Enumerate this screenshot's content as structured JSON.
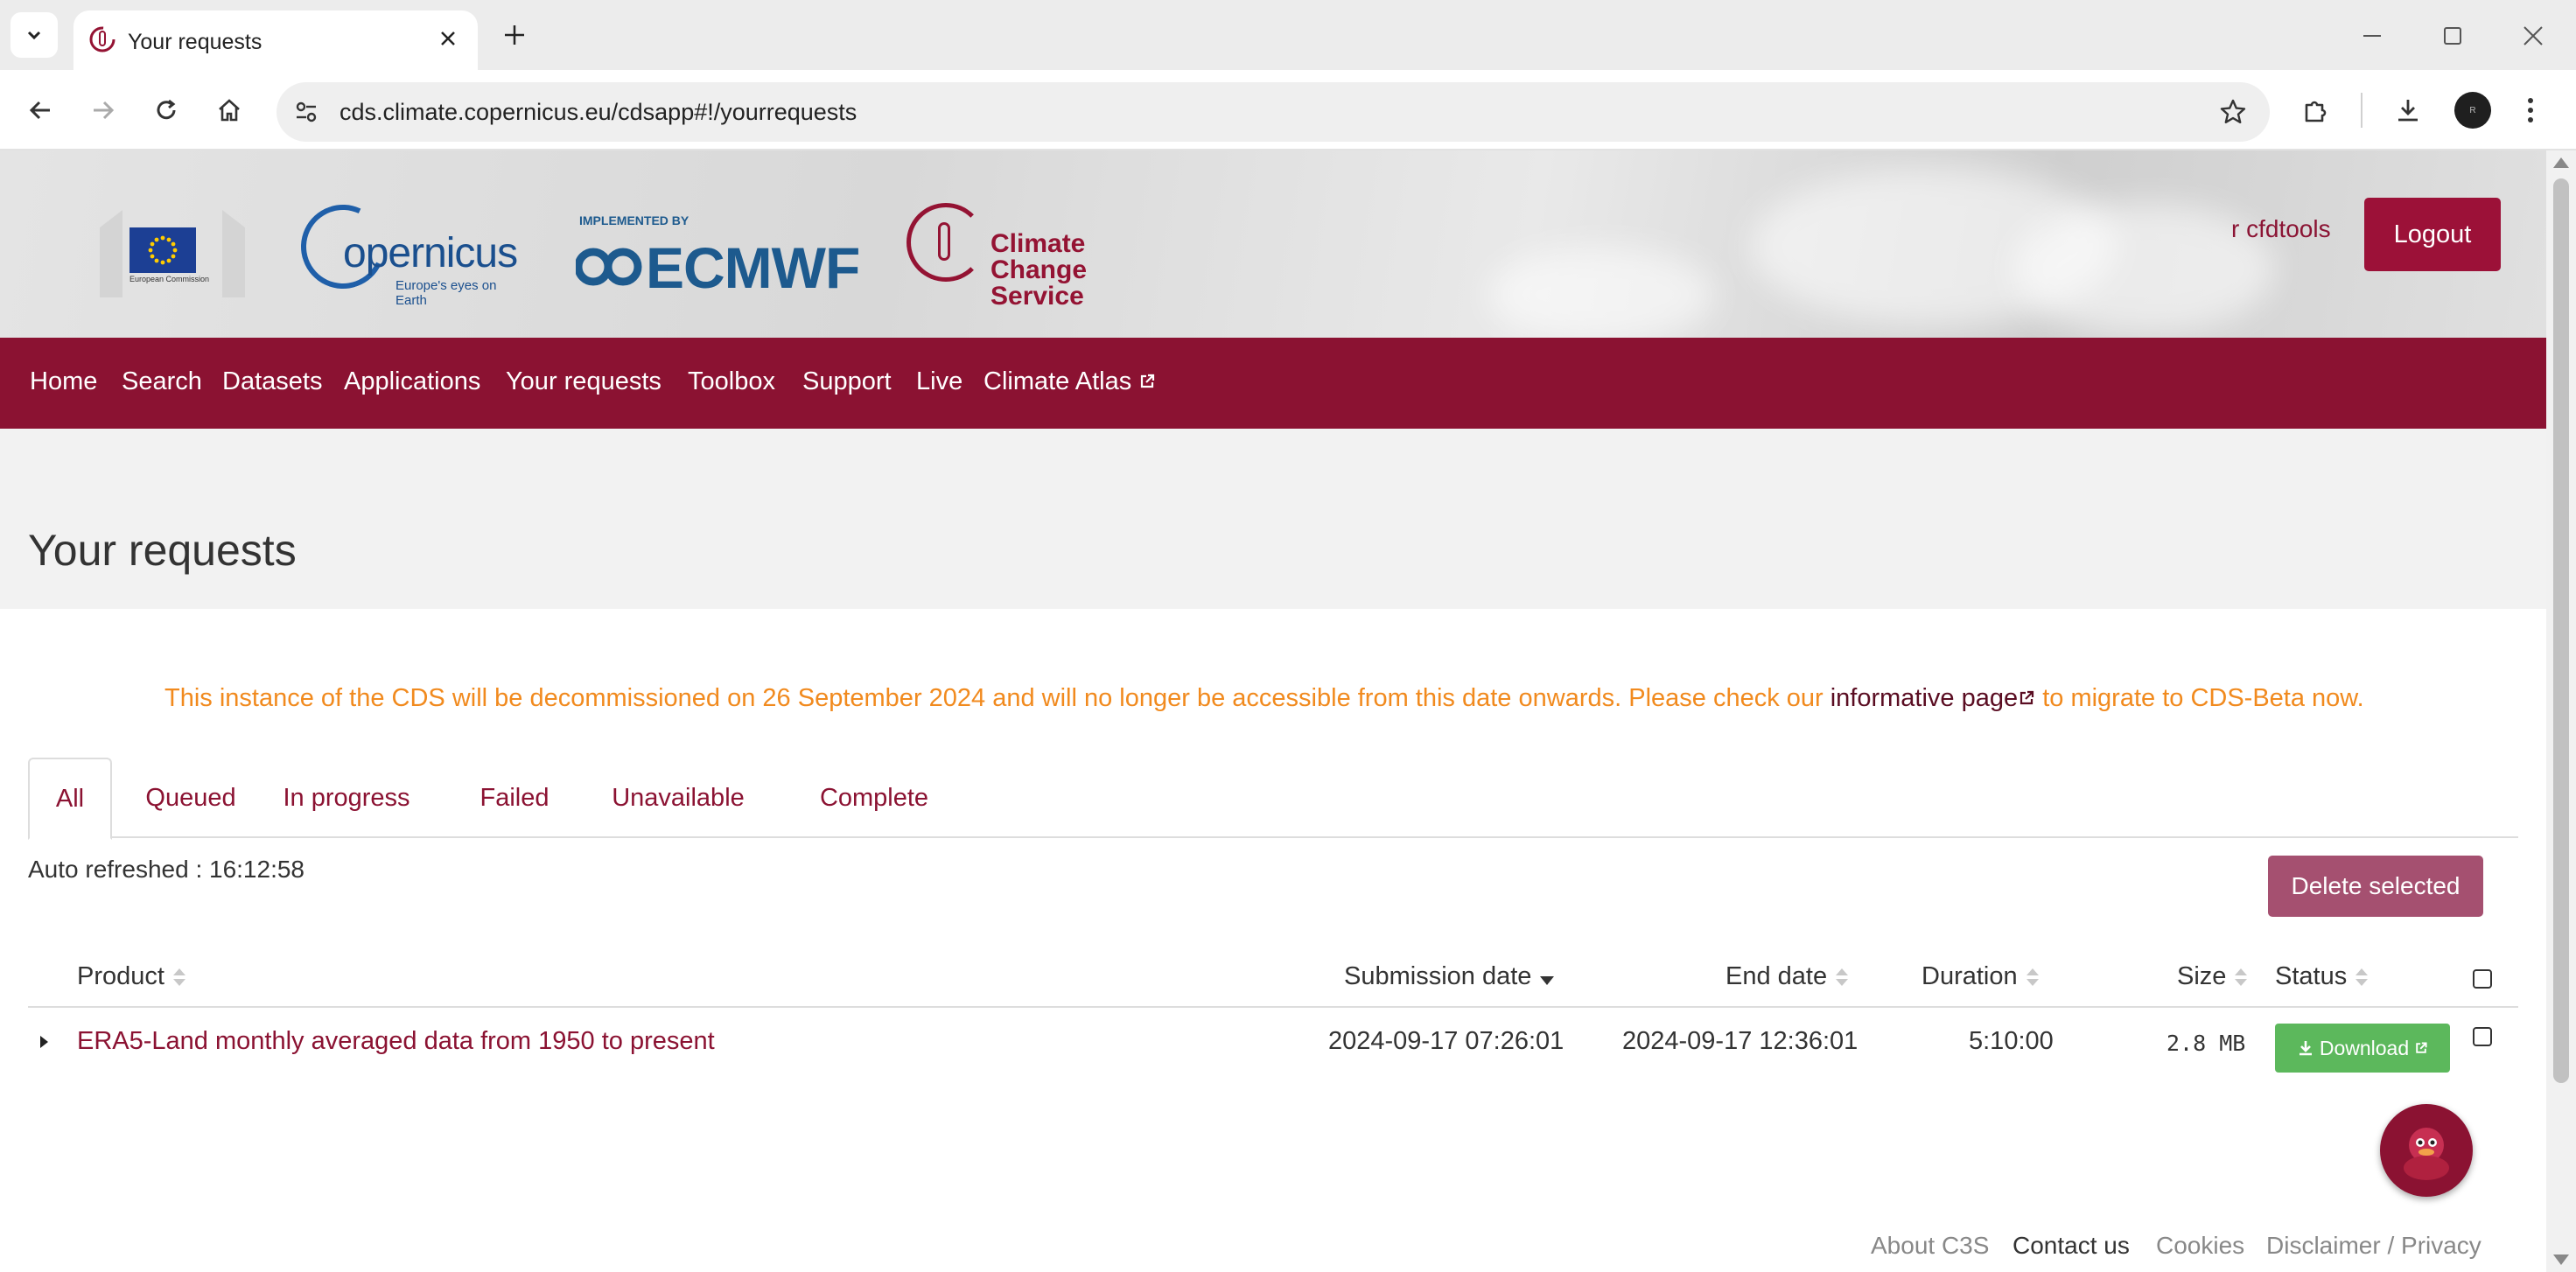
{
  "browser": {
    "tab_title": "Your requests",
    "url": "cds.climate.copernicus.eu/cdsapp#!/yourrequests",
    "profile_initials": "R"
  },
  "header": {
    "ec_text": "European Commission",
    "copernicus_word": "opernicus",
    "copernicus_tagline": "Europe's eyes on Earth",
    "ecmwf_implemented": "IMPLEMENTED BY",
    "ecmwf_word": "ECMWF",
    "c3s_line1": "Climate Change",
    "c3s_line2": "Service",
    "username": "r cfdtools",
    "logout_label": "Logout"
  },
  "nav": {
    "items": [
      "Home",
      "Search",
      "Datasets",
      "Applications",
      "Your requests",
      "Toolbox",
      "Support",
      "Live",
      "Climate Atlas"
    ]
  },
  "page": {
    "title": "Your requests",
    "notice_before": "This instance of the CDS will be decommissioned on 26 September 2024 and will no longer be accessible from this date onwards. Please check our ",
    "notice_link": "informative page",
    "notice_after": " to migrate to CDS-Beta now.",
    "tabs": [
      "All",
      "Queued",
      "In progress",
      "Failed",
      "Unavailable",
      "Complete"
    ],
    "active_tab": "All",
    "auto_refreshed": "Auto refreshed : 16:12:58",
    "delete_selected": "Delete selected"
  },
  "table": {
    "headers": {
      "product": "Product",
      "submission_date": "Submission date",
      "end_date": "End date",
      "duration": "Duration",
      "size": "Size",
      "status": "Status"
    },
    "rows": [
      {
        "product": "ERA5-Land monthly averaged data from 1950 to present",
        "submission_date": "2024-09-17 07:26:01",
        "end_date": "2024-09-17 12:36:01",
        "duration": "5:10:00",
        "size": "2.8 MB",
        "status_button": "Download"
      }
    ]
  },
  "footer": {
    "about": "About C3S",
    "contact": "Contact us",
    "cookies": "Cookies",
    "disclaimer": "Disclaimer / Privacy"
  },
  "colors": {
    "brand": "#8b1232",
    "notice": "#f18a1e",
    "download": "#5cb85c"
  }
}
